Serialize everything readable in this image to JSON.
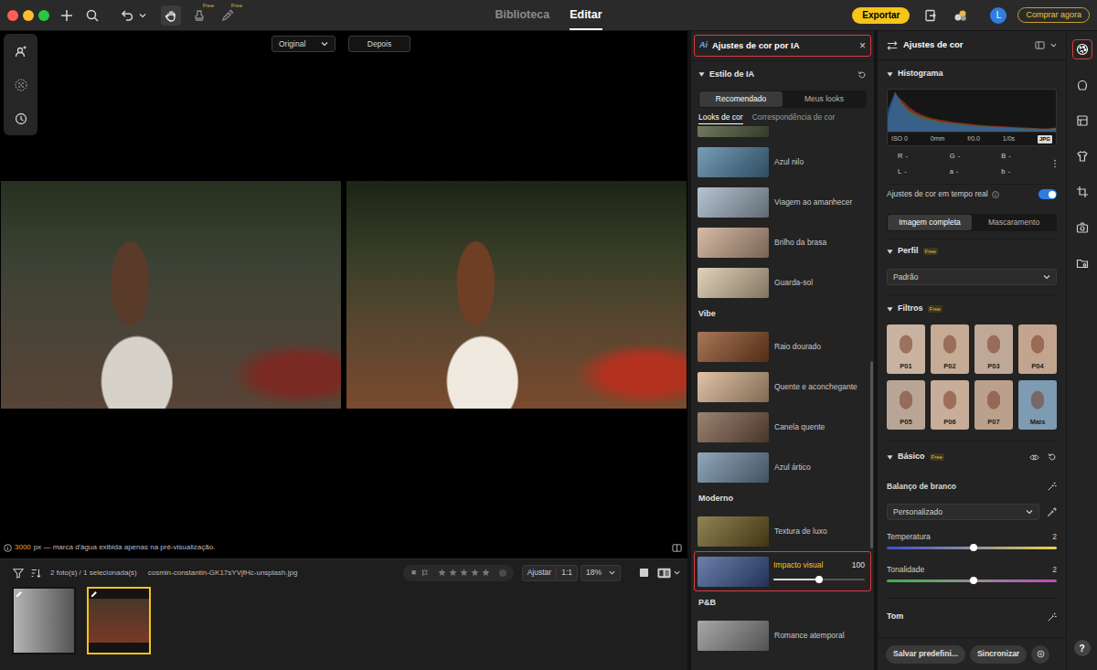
{
  "top_bar": {
    "window_controls": [
      {
        "color": "#ff5f57"
      },
      {
        "color": "#febc2e"
      },
      {
        "color": "#28c840"
      }
    ],
    "hand_tool_selected": true,
    "tool_badges": [
      "Free",
      "Free"
    ],
    "tabs": [
      {
        "label": "Biblioteca",
        "selected": false
      },
      {
        "label": "Editar",
        "selected": true
      }
    ],
    "export_button": "Exportar",
    "avatar": "L",
    "buy_button": "Comprar agora"
  },
  "canvas": {
    "compare_mode": "Original",
    "after_button": "Depois",
    "resolution": "3000",
    "watermark_note": "px — marca d'água exibida apenas na pré-visualização."
  },
  "filmstrip": {
    "count": "2 foto(s) / 1 selecionada(s)",
    "filename": "cosmin-constantin-GK17sYVjfHc-unsplash.jpg",
    "stars": 0,
    "fit_button": "Ajustar",
    "ratio_button": "1:1",
    "zoom": "18%",
    "thumbnails": [
      {
        "kind": "portrait",
        "selected": false,
        "edited": true,
        "color": "#8c8c8c"
      },
      {
        "kind": "landscape",
        "selected": true,
        "edited": true,
        "color": "#5a4630"
      }
    ]
  },
  "ai_panel": {
    "badge": "Ai",
    "title": "Ajustes de cor por IA",
    "close": "×",
    "section": {
      "title": "Estilo de IA",
      "expanded": true
    },
    "tabs": [
      {
        "label": "Recomendado",
        "selected": true
      },
      {
        "label": "Meus looks",
        "selected": false
      }
    ],
    "subtabs": [
      {
        "label": "Looks de cor",
        "selected": true
      },
      {
        "label": "Correspondência de cor",
        "selected": false
      }
    ],
    "looks": [
      {
        "kind": "partial",
        "color": "#55603f"
      },
      {
        "kind": "look",
        "label": "Azul nilo",
        "selected": false,
        "color": "#4a7ea0"
      },
      {
        "kind": "look",
        "label": "Viagem ao amanhecer",
        "selected": false,
        "color": "#9fb2c2"
      },
      {
        "kind": "look",
        "label": "Brilho da brasa",
        "selected": false,
        "color": "#c9a58a"
      },
      {
        "kind": "look",
        "label": "Guarda-sol",
        "selected": false,
        "color": "#d8c3a2"
      },
      {
        "kind": "heading",
        "label": "Vibe"
      },
      {
        "kind": "look",
        "label": "Raio dourado",
        "selected": false,
        "color": "#8a4a22"
      },
      {
        "kind": "look",
        "label": "Quente e aconchegante",
        "selected": false,
        "color": "#d6b08a"
      },
      {
        "kind": "look",
        "label": "Canela quente",
        "selected": false,
        "color": "#7a5a44"
      },
      {
        "kind": "look",
        "label": "Azul ártico",
        "selected": false,
        "color": "#6d8aa3"
      },
      {
        "kind": "heading",
        "label": "Moderno"
      },
      {
        "kind": "look",
        "label": "Textura de luxo",
        "selected": false,
        "color": "#6b5a1e"
      },
      {
        "kind": "look",
        "label": "Impacto visual",
        "selected": true,
        "level": 0.5,
        "reading": "100",
        "color": "#3a5590"
      },
      {
        "kind": "heading",
        "label": "P&B"
      },
      {
        "kind": "look",
        "label": "Romance atemporal",
        "selected": false,
        "color": "#8a8a8a"
      }
    ]
  },
  "adjust_panel": {
    "title": "Ajustes de cor",
    "histogram": {
      "title": "Histograma",
      "expanded": true,
      "series": [
        {
          "color": "#c0392b",
          "values": [
            30,
            92,
            78,
            60,
            48,
            40,
            34,
            30,
            27,
            24,
            22,
            20,
            18,
            16,
            15,
            14,
            13,
            12,
            11,
            10,
            9,
            8,
            8,
            10
          ]
        },
        {
          "color": "#2e8b57",
          "values": [
            40,
            100,
            70,
            52,
            42,
            35,
            30,
            26,
            23,
            21,
            19,
            17,
            15,
            14,
            13,
            12,
            11,
            10,
            9,
            8,
            8,
            7,
            7,
            9
          ]
        },
        {
          "color": "#2b5fb8",
          "values": [
            55,
            96,
            64,
            46,
            36,
            30,
            26,
            22,
            20,
            18,
            16,
            15,
            13,
            12,
            11,
            10,
            9,
            9,
            8,
            7,
            7,
            6,
            6,
            8
          ]
        }
      ],
      "exif": [
        "ISO 0",
        "0mm",
        "f/0.0",
        "1/0s"
      ],
      "format": "JPG"
    },
    "readouts": [
      {
        "label": "R",
        "value": "-"
      },
      {
        "label": "G",
        "value": "-"
      },
      {
        "label": "B",
        "value": "-"
      },
      {
        "label": "L",
        "value": "-"
      },
      {
        "label": "a",
        "value": "-"
      },
      {
        "label": "b",
        "value": "-"
      }
    ],
    "realtime": {
      "label": "Ajustes de cor em tempo real",
      "on": true
    },
    "scope_tabs": [
      {
        "label": "Imagem completa",
        "selected": true
      },
      {
        "label": "Mascaramento",
        "selected": false
      }
    ],
    "profile": {
      "title": "Perfil",
      "badge": "Free",
      "expanded": true,
      "value": "Padrão"
    },
    "filters": {
      "title": "Filtros",
      "badge": "Free",
      "expanded": true,
      "items": [
        {
          "label": "P01",
          "color": "#c9b2a0"
        },
        {
          "label": "P02",
          "color": "#c6ab95"
        },
        {
          "label": "P03",
          "color": "#bfa898"
        },
        {
          "label": "P04",
          "color": "#c3a48e"
        },
        {
          "label": "P05",
          "color": "#b9a595"
        },
        {
          "label": "P06",
          "color": "#c7ad9a"
        },
        {
          "label": "P07",
          "color": "#bba08e"
        },
        {
          "label": "Mais",
          "color": "#7d9bb3"
        }
      ]
    },
    "basic": {
      "title": "Básico",
      "badge": "Free",
      "expanded": true,
      "white_balance": {
        "label": "Balanço de branco",
        "value": "Personalizado"
      },
      "sliders": [
        {
          "kind": "temperature",
          "label": "Temperatura",
          "reading": "2",
          "level": 0.51
        },
        {
          "kind": "tint",
          "label": "Tonalidade",
          "reading": "2",
          "level": 0.51
        }
      ]
    },
    "tone": {
      "title": "Tom"
    },
    "buttons": [
      "Salvar predefini...",
      "Sincronizar"
    ]
  },
  "rail": {
    "items": [
      {
        "selected": true
      },
      {
        "selected": false
      },
      {
        "selected": false
      },
      {
        "selected": false
      },
      {
        "selected": false
      },
      {
        "selected": false
      },
      {
        "selected": false
      }
    ],
    "help": "?"
  }
}
